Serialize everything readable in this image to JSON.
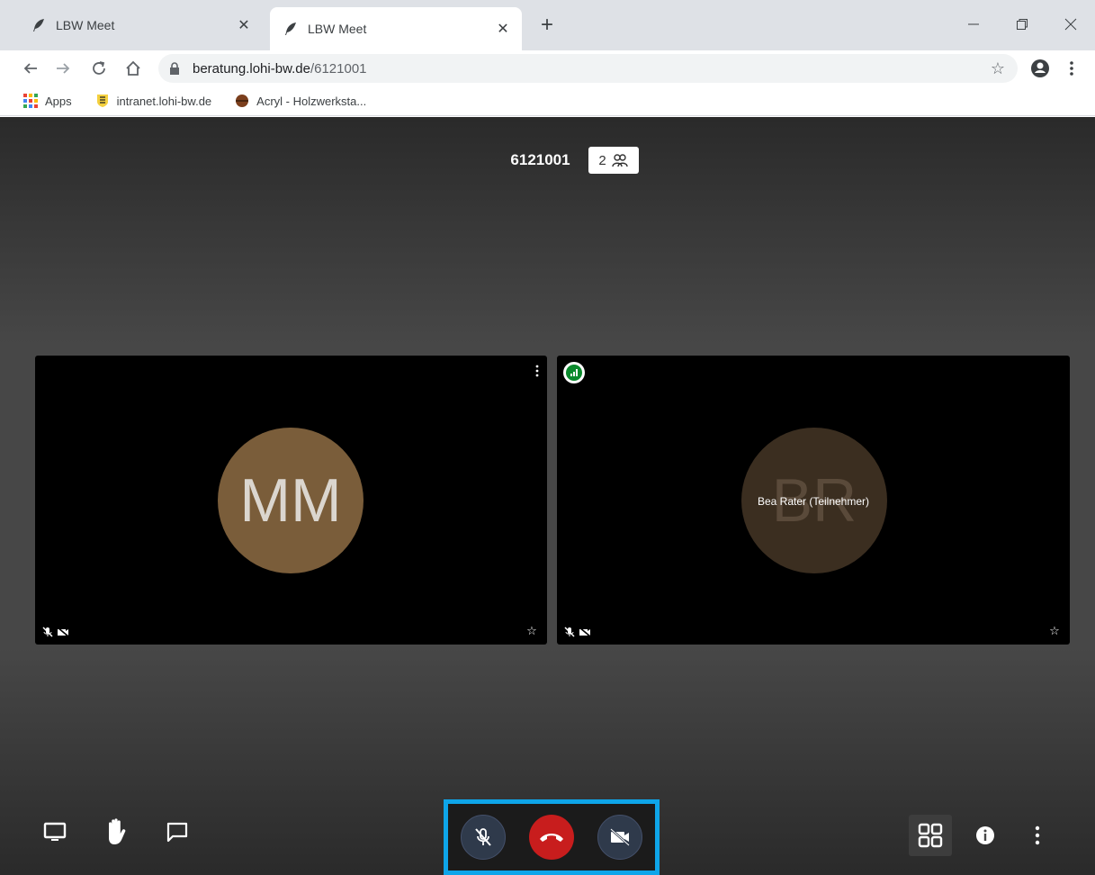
{
  "browser": {
    "tabs": [
      {
        "label": "LBW Meet",
        "active": false
      },
      {
        "label": "LBW Meet",
        "active": true
      }
    ],
    "new_tab_label": "+",
    "url_domain": "beratung.lohi-bw.de",
    "url_path": "/6121001",
    "bookmarks": [
      {
        "label": "Apps",
        "icon": "apps-grid-icon"
      },
      {
        "label": "intranet.lohi-bw.de",
        "icon": "crest-icon"
      },
      {
        "label": "Acryl - Holzwerksta...",
        "icon": "wood-ball-icon"
      }
    ]
  },
  "meeting": {
    "room_name": "6121001",
    "participant_count": "2",
    "tiles": [
      {
        "initials": "MM",
        "display_name": ""
      },
      {
        "initials": "BR",
        "display_name": "Bea Rater (Teilnehmer)",
        "connection": "good"
      }
    ]
  },
  "colors": {
    "highlight_border": "#0ea5e9",
    "hangup": "#c81d1d",
    "connection_good": "#0a8a2c",
    "avatar_mm": "#7a5d3a",
    "avatar_br": "#3b2e20"
  }
}
